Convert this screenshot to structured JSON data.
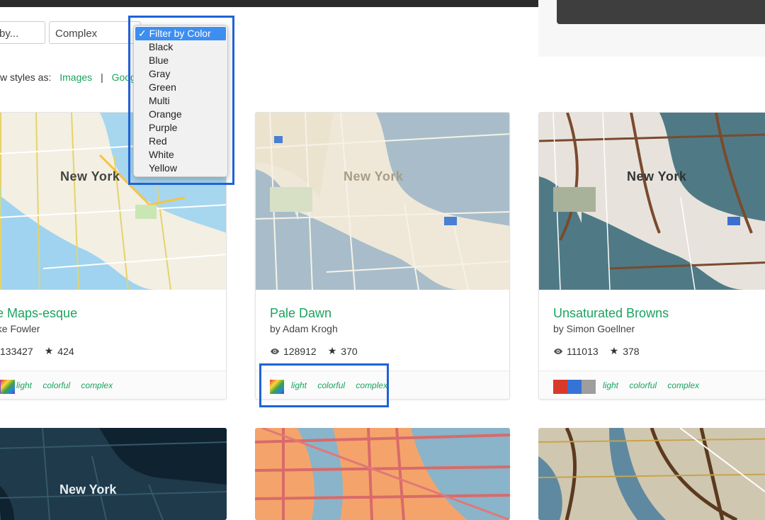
{
  "filters": {
    "sort_value": "by...",
    "complexity_value": "Complex",
    "color_dropdown": {
      "selected": "Filter by Color",
      "check_glyph": "✓",
      "options": [
        "Black",
        "Blue",
        "Gray",
        "Green",
        "Multi",
        "Orange",
        "Purple",
        "Red",
        "White",
        "Yellow"
      ]
    }
  },
  "view_styles": {
    "label": "w styles as:",
    "images_link": "Images",
    "separator": "|",
    "google_link": "Googl"
  },
  "cards": [
    {
      "title": "ple Maps-esque",
      "author": "Mike Fowler",
      "views": "133427",
      "stars": "424",
      "swatch_colors": [
        "#8a44d9",
        "multi"
      ],
      "tags": [
        "light",
        "colorful",
        "complex"
      ],
      "map": {
        "city": "New York",
        "water": "#9fd3ef",
        "land": "#f3efe3"
      }
    },
    {
      "title": "Pale Dawn",
      "author": "by Adam Krogh",
      "views": "128912",
      "stars": "370",
      "swatch_colors": [
        "multi"
      ],
      "tags": [
        "light",
        "colorful",
        "complex"
      ],
      "map": {
        "city": "New York",
        "water": "#a8bdc9",
        "land": "#efe8d8"
      }
    },
    {
      "title": "Unsaturated Browns",
      "author": "by Simon Goellner",
      "views": "111013",
      "stars": "378",
      "swatch_colors": [
        "#d9392b",
        "#3573d6",
        "#9e9e9e"
      ],
      "tags": [
        "light",
        "colorful",
        "complex"
      ],
      "map": {
        "city": "New York",
        "water": "#4f7a85",
        "land": "#e7e3dc"
      }
    }
  ],
  "bottom_cards": [
    {
      "city": "New York",
      "style": "dark-blue"
    },
    {
      "city": "",
      "style": "orange"
    },
    {
      "city": "",
      "style": "brown"
    }
  ],
  "icons": {
    "eye": "eye-icon",
    "star": "star-icon"
  },
  "colors": {
    "accent_green": "#1aa35e",
    "highlight_blue": "#1f63d6",
    "dropdown_selected": "#3d8ef0"
  }
}
